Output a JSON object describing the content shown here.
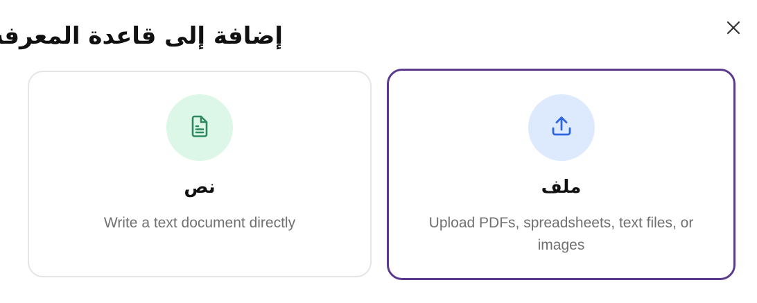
{
  "dialog": {
    "title": "إضافة إلى قاعدة المعرفة",
    "close_icon": "close-icon"
  },
  "options": {
    "text": {
      "title": "نص",
      "description": "Write a text document directly",
      "icon": "document-icon",
      "icon_color": "#2e8a5e",
      "icon_bg": "#dcf6e8",
      "selected": false
    },
    "file": {
      "title": "ملف",
      "description": "Upload PDFs, spreadsheets, text files, or images",
      "icon": "upload-icon",
      "icon_color": "#2f66e0",
      "icon_bg": "#dde9fd",
      "selected": true
    }
  },
  "colors": {
    "selected_border": "#5b3a8e",
    "card_border": "#e5e5e5",
    "description_text": "#707070"
  }
}
